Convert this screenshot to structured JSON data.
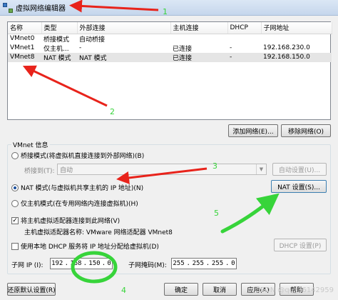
{
  "window": {
    "title": "虚拟网络编辑器"
  },
  "table": {
    "headers": [
      "名称",
      "类型",
      "外部连接",
      "主机连接",
      "DHCP",
      "子网地址"
    ],
    "rows": [
      [
        "VMnet0",
        "桥接模式",
        "自动桥接",
        "",
        "",
        ""
      ],
      [
        "VMnet1",
        "仅主机...",
        "-",
        "已连接",
        "-",
        "192.168.230.0"
      ],
      [
        "VMnet8",
        "NAT 模式",
        "NAT 模式",
        "已连接",
        "-",
        "192.168.150.0"
      ]
    ],
    "selected_row": 2
  },
  "buttons": {
    "add_network": "添加网络(E)...",
    "remove_network": "移除网络(O)",
    "auto_settings": "自动设置(U)...",
    "nat_settings": "NAT 设置(S)...",
    "dhcp_settings": "DHCP 设置(P)",
    "restore_defaults": "还原默认设置(R)",
    "ok": "确定",
    "cancel": "取消",
    "apply": "应用(A)",
    "help": "帮助"
  },
  "vmnet_info": {
    "title": "VMnet 信息",
    "bridged_label": "桥接模式(将虚拟机直接连接到外部网络)(B)",
    "bridged_to_label": "桥接到(T):",
    "bridged_to_value": "自动",
    "nat_label": "NAT 模式(与虚拟机共享主机的 IP 地址)(N)",
    "hostonly_label": "仅主机模式(在专用网络内连接虚拟机)(H)",
    "connect_adapter_label": "将主机虚拟适配器连接到此网络(V)",
    "adapter_name_label": "主机虚拟适配器名称: VMware 网络适配器 VMnet8",
    "use_dhcp_label": "使用本地 DHCP 服务将 IP 地址分配给虚拟机(D)",
    "selected_mode": "nat",
    "connect_adapter_checked": true,
    "use_dhcp_checked": false
  },
  "subnet": {
    "ip_label": "子网 IP (I):",
    "ip_octets": [
      "192",
      "168",
      "150",
      "0"
    ],
    "mask_label": "子网掩码(M):",
    "mask_octets": [
      "255",
      "255",
      "255",
      "0"
    ]
  },
  "annotations": [
    "1",
    "2",
    "3",
    "4",
    "5"
  ],
  "watermark": "CSDN @qq_36142959",
  "colors": {
    "arrow": "#e8231b",
    "highlight": "#37d43a"
  }
}
